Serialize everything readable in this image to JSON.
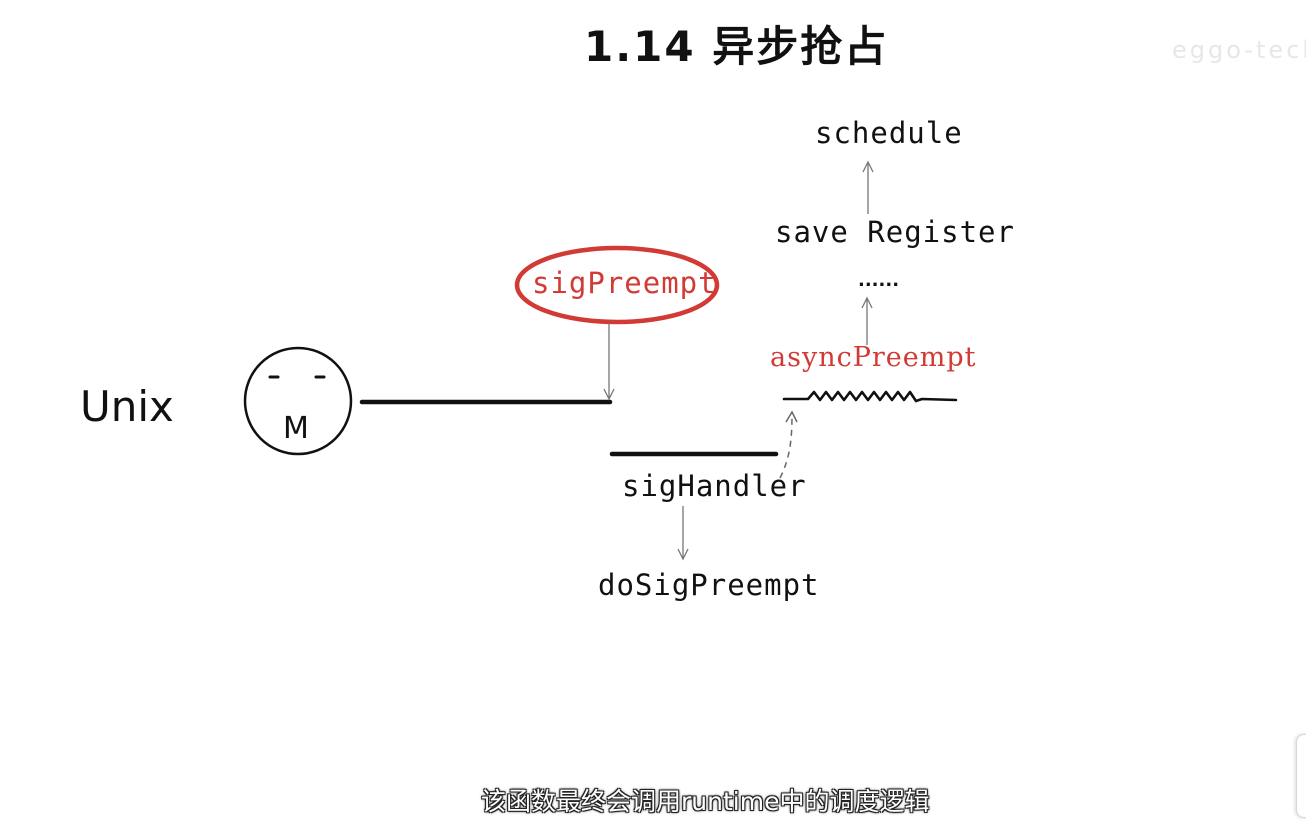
{
  "title": "1.14 异步抢占",
  "watermark": "eggo-tech",
  "nodes": {
    "unix": "Unix",
    "m_thread": "M",
    "sig_preempt": "sigPreempt",
    "sig_handler": "sigHandler",
    "do_sig_preempt": "doSigPreempt",
    "async_preempt": "asyncPreempt",
    "ellipsis": "......",
    "save_register": "save Register",
    "schedule": "schedule"
  },
  "subtitle": "该函数最终会调用runtime中的调度逻辑",
  "colors": {
    "ink": "#111111",
    "highlight_red": "#d23a35",
    "arrow_gray": "#777777",
    "background": "#ffffff",
    "subtitle_text": "#ffffff",
    "subtitle_outline": "#222222"
  },
  "icons": {
    "m_face": "smiley-circle-icon",
    "highlight": "red-ellipse-highlight"
  }
}
